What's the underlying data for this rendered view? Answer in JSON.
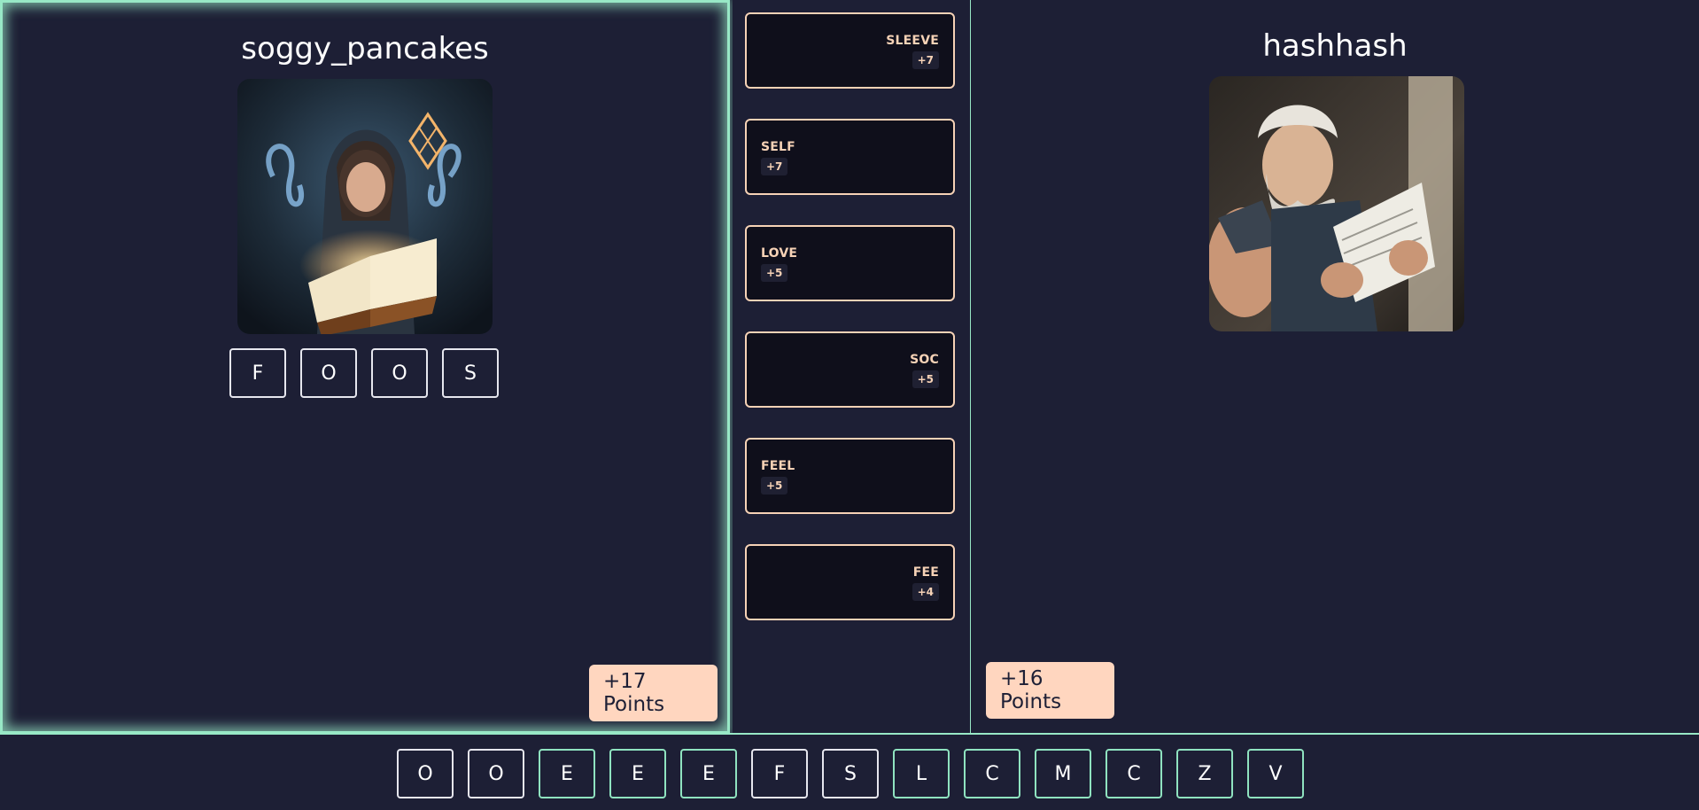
{
  "players": {
    "left": {
      "name": "soggy_pancakes",
      "avatar": "wizard-reading-book-avatar",
      "word_tiles": [
        "F",
        "O",
        "O",
        "S"
      ],
      "points_label": "+17 Points",
      "active": true
    },
    "right": {
      "name": "hashhash",
      "avatar": "dwarf-reading-scroll-avatar",
      "points_label": "+16 Points",
      "active": false
    }
  },
  "words": [
    {
      "word": "SLEEVE",
      "score": "+7",
      "side": "right"
    },
    {
      "word": "SELF",
      "score": "+7",
      "side": "left"
    },
    {
      "word": "LOVE",
      "score": "+5",
      "side": "left"
    },
    {
      "word": "SOC",
      "score": "+5",
      "side": "right"
    },
    {
      "word": "FEEL",
      "score": "+5",
      "side": "left"
    },
    {
      "word": "FEE",
      "score": "+4",
      "side": "right"
    }
  ],
  "rack": [
    {
      "letter": "O",
      "state": "used"
    },
    {
      "letter": "O",
      "state": "used"
    },
    {
      "letter": "E",
      "state": "available"
    },
    {
      "letter": "E",
      "state": "available"
    },
    {
      "letter": "E",
      "state": "available"
    },
    {
      "letter": "F",
      "state": "used"
    },
    {
      "letter": "S",
      "state": "used"
    },
    {
      "letter": "L",
      "state": "available"
    },
    {
      "letter": "C",
      "state": "available"
    },
    {
      "letter": "M",
      "state": "available"
    },
    {
      "letter": "C",
      "state": "available"
    },
    {
      "letter": "Z",
      "state": "available"
    },
    {
      "letter": "V",
      "state": "available"
    }
  ],
  "colors": {
    "background": "#1d1f35",
    "accent_green": "#98e8c6",
    "accent_peach": "#ffd6bf",
    "card_bg": "#0f0f1b"
  }
}
